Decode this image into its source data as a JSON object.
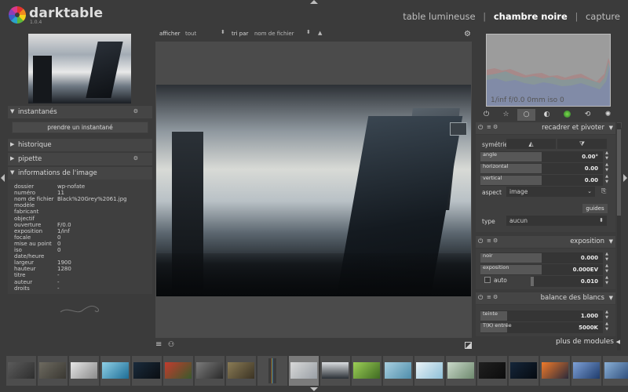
{
  "app": {
    "name": "darktable",
    "version": "1.0.4"
  },
  "views": {
    "lighttable": "table lumineuse",
    "darkroom": "chambre noire",
    "tethering": "capture",
    "separator": "|"
  },
  "left": {
    "snapshots": {
      "title": "instantanés",
      "button": "prendre un instantané"
    },
    "history": {
      "title": "historique"
    },
    "tagging": {
      "title": "pipette"
    },
    "imageinfo": {
      "title": "informations de l'image",
      "rows": [
        {
          "k": "dossier",
          "v": "wp-nofate"
        },
        {
          "k": "numéro",
          "v": "11"
        },
        {
          "k": "nom de fichier",
          "v": "Black%20Grey%2061.jpg"
        },
        {
          "k": "modèle",
          "v": ""
        },
        {
          "k": "fabricant",
          "v": ""
        },
        {
          "k": "objectif",
          "v": ""
        },
        {
          "k": "ouverture",
          "v": "F/0.0"
        },
        {
          "k": "exposition",
          "v": "1/inf"
        },
        {
          "k": "focale",
          "v": "0"
        },
        {
          "k": "mise au point",
          "v": "0"
        },
        {
          "k": "iso",
          "v": "0"
        },
        {
          "k": "date/heure",
          "v": ""
        },
        {
          "k": "largeur",
          "v": "1900"
        },
        {
          "k": "hauteur",
          "v": "1280"
        },
        {
          "k": "titre",
          "v": "-"
        },
        {
          "k": "auteur",
          "v": "-"
        },
        {
          "k": "droits",
          "v": "-"
        }
      ]
    }
  },
  "center": {
    "show_label": "afficher",
    "show_value": "tout",
    "sort_label": "tri par",
    "sort_value": "nom de fichier",
    "updown": "⬍",
    "sort_dir": "▲"
  },
  "right": {
    "histogram_info": "1/inf f/0.0 0mm iso 0",
    "groups": [
      {
        "icon": "power-icon",
        "glyph": "⏻"
      },
      {
        "icon": "star-icon",
        "glyph": "☆"
      },
      {
        "icon": "circle-icon",
        "glyph": "○"
      },
      {
        "icon": "half-circle-icon",
        "glyph": "◐"
      },
      {
        "icon": "color-icon",
        "glyph": "●"
      },
      {
        "icon": "correct-icon",
        "glyph": "⟲"
      },
      {
        "icon": "effect-icon",
        "glyph": "✺"
      }
    ],
    "crop": {
      "title": "recadrer et pivoter",
      "flip_label": "symétrie",
      "flip_h": "◭",
      "flip_v": "⧩",
      "sliders": [
        {
          "name": "angle",
          "value": "0.00°"
        },
        {
          "name": "horizontal",
          "value": "0.00"
        },
        {
          "name": "vertical",
          "value": "0.00"
        }
      ],
      "aspect_label": "aspect",
      "aspect_value": "image",
      "guides": "guides",
      "type_label": "type",
      "type_value": "aucun"
    },
    "exposure": {
      "title": "exposition",
      "sliders": [
        {
          "name": "noir",
          "value": "0.000"
        },
        {
          "name": "exposition",
          "value": "0.000EV"
        },
        {
          "name": "auto",
          "value": "0.010"
        }
      ]
    },
    "wb": {
      "title": "balance des blancs",
      "sliders": [
        {
          "name": "teinte",
          "value": "1.000"
        },
        {
          "name": "T(K) entrée",
          "value": "5000K"
        }
      ]
    },
    "more_modules": "plus de modules"
  },
  "colors": {
    "accent_exposure_fill": "#575757",
    "panel_bg": "#3b3b3b"
  }
}
